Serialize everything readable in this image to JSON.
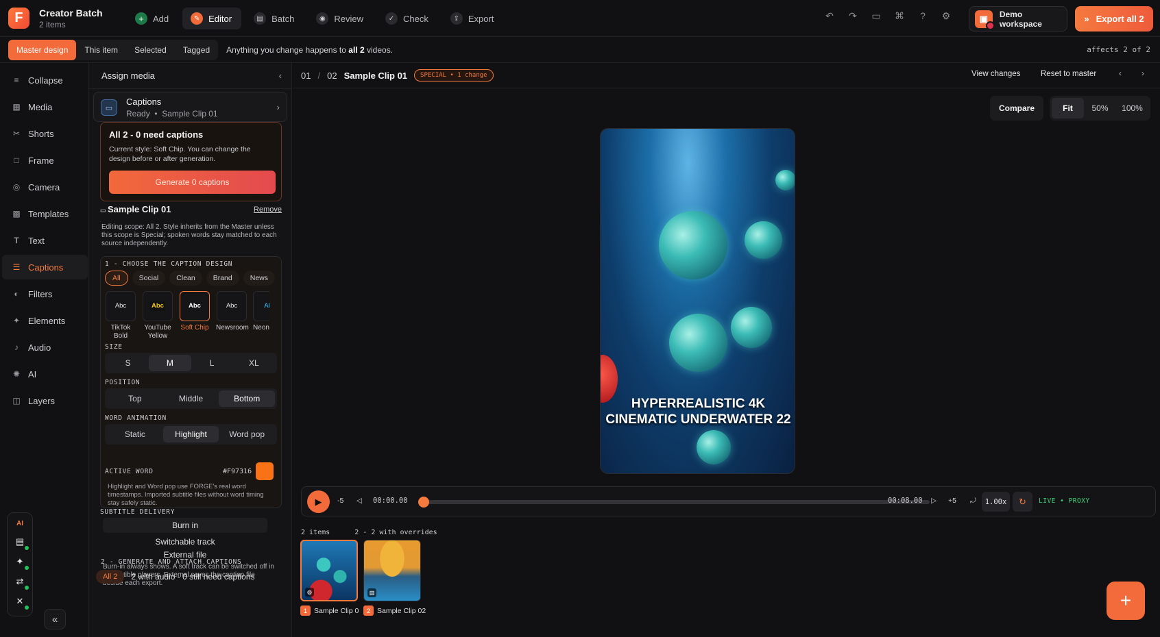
{
  "app": {
    "name": "Creator Batch",
    "count_label": "2 items"
  },
  "nav": {
    "tabs": [
      {
        "label": "Add",
        "icon": "plus-icon"
      },
      {
        "label": "Editor",
        "icon": "editor-icon",
        "active": true
      },
      {
        "label": "Batch",
        "icon": "batch-icon"
      },
      {
        "label": "Review",
        "icon": "review-icon"
      },
      {
        "label": "Check",
        "icon": "check-icon"
      },
      {
        "label": "Export",
        "icon": "export-icon"
      }
    ]
  },
  "header": {
    "workspace": "Demo workspace",
    "export_all": "Export all 2"
  },
  "scope": {
    "tabs": [
      "Master design",
      "This item",
      "Selected",
      "Tagged"
    ],
    "active": "Master design",
    "note_prefix": "Anything you change happens to",
    "note_bold": "all 2",
    "note_suffix": "videos.",
    "affects": "affects 2 of 2"
  },
  "sidebar": {
    "items": [
      {
        "label": "Collapse",
        "icon": "collapse-icon"
      },
      {
        "label": "Media",
        "icon": "media-icon"
      },
      {
        "label": "Shorts",
        "icon": "scissors-icon"
      },
      {
        "label": "Frame",
        "icon": "frame-icon"
      },
      {
        "label": "Camera",
        "icon": "camera-icon"
      },
      {
        "label": "Templates",
        "icon": "templates-icon"
      },
      {
        "label": "Text",
        "icon": "text-icon"
      },
      {
        "label": "Captions",
        "icon": "captions-icon",
        "active": true
      },
      {
        "label": "Filters",
        "icon": "filters-icon"
      },
      {
        "label": "Elements",
        "icon": "elements-icon"
      },
      {
        "label": "Audio",
        "icon": "audio-icon"
      },
      {
        "label": "AI",
        "icon": "ai-icon"
      },
      {
        "label": "Layers",
        "icon": "layers-icon"
      }
    ],
    "ai_rail_label": "AI"
  },
  "panel": {
    "title": "Assign media",
    "captions_card": {
      "title": "Captions",
      "status": "Ready",
      "clip": "Sample Clip 01"
    },
    "need": {
      "title": "All 2 - 0 need captions",
      "desc": "Current style: Soft Chip. You can change the design before or after generation.",
      "button": "Generate 0 captions"
    },
    "clip": {
      "name": "Sample Clip 01",
      "remove": "Remove"
    },
    "scope_text": "Editing scope: All 2. Style inherits from the Master unless this scope is Special; spoken words stay matched to each source independently.",
    "design": {
      "section1": "1 - CHOOSE THE CAPTION DESIGN",
      "filters": [
        "All",
        "Social",
        "Clean",
        "Brand",
        "News"
      ],
      "styles": [
        {
          "name": "TikTok Bold",
          "sample": "Abc"
        },
        {
          "name": "YouTube Yellow",
          "sample": "Abc"
        },
        {
          "name": "Soft Chip",
          "sample": "Abc",
          "selected": true
        },
        {
          "name": "Newsroom",
          "sample": "Abc"
        },
        {
          "name": "Neon",
          "sample": "Ab"
        }
      ],
      "size_label": "SIZE",
      "sizes": [
        "S",
        "M",
        "L",
        "XL"
      ],
      "size_selected": "M",
      "position_label": "POSITION",
      "positions": [
        "Top",
        "Middle",
        "Bottom"
      ],
      "position_selected": "Bottom",
      "animation_label": "WORD ANIMATION",
      "animations": [
        "Static",
        "Highlight",
        "Word pop"
      ],
      "animation_selected": "Highlight",
      "active_word_label": "ACTIVE WORD",
      "active_word_color": "#F97316",
      "hint": "Highlight and Word pop use FORGE's real word timestamps. Imported subtitle files without word timing stay safely static."
    },
    "delivery": {
      "label": "SUBTITLE DELIVERY",
      "options": [
        "Burn in",
        "Switchable track",
        "External file"
      ],
      "selected": "Burn in",
      "note": "Burn-in always shows. A soft track can be switched off in compatible players. External saves the caption file beside each export."
    },
    "generate": {
      "label": "2 - GENERATE AND ATTACH CAPTIONS",
      "chip": "All 2",
      "text": "2 with audio - 0 still need captions"
    }
  },
  "preview": {
    "index": "01",
    "total": "02",
    "clip_name": "Sample Clip 01",
    "badge": "SPECIAL • 1 change",
    "view_changes": "View changes",
    "reset": "Reset to master",
    "compare": "Compare",
    "zoom": [
      "Fit",
      "50%",
      "100%"
    ],
    "zoom_selected": "Fit",
    "caption_line1": "HYPERREALISTIC 4K",
    "caption_line2": "CINEMATIC UNDERWATER 22"
  },
  "transport": {
    "back": "-5",
    "current": "00:00.00",
    "duration": "00:08.00",
    "forward": "+5",
    "speed": "1.00x",
    "status": "LIVE • PROXY",
    "progress": 0.0
  },
  "filmstrip": {
    "info_count": "2 items",
    "info_overrides": "2 - 2 with overrides",
    "items": [
      {
        "num": "1",
        "name": "Sample Clip 0"
      },
      {
        "num": "2",
        "name": "Sample Clip 02"
      }
    ]
  },
  "colors": {
    "accent": "#F36B3B",
    "live": "#3DD37A",
    "active_word": "#F97316"
  }
}
